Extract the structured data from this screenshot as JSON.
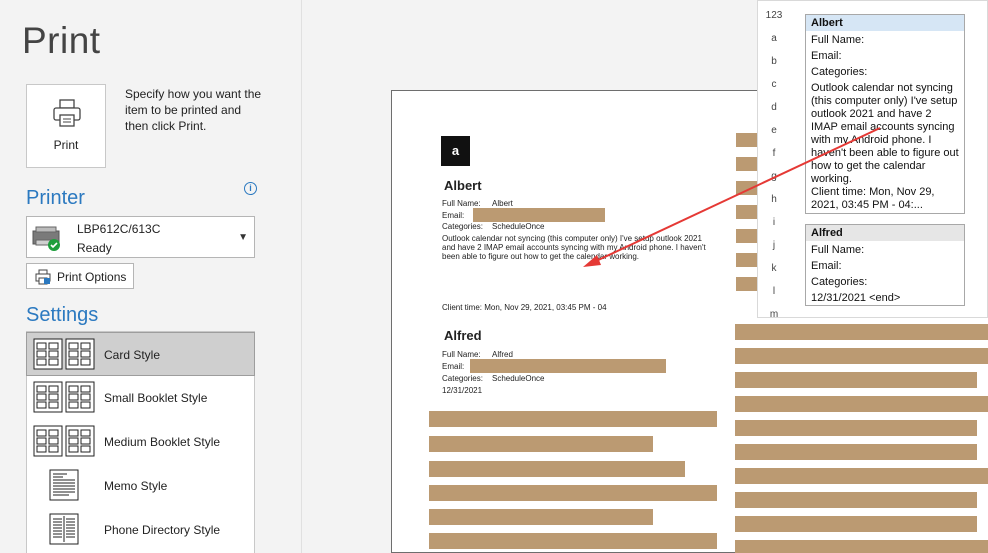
{
  "title": "Print",
  "print_button": {
    "label": "Print"
  },
  "instructions": "Specify how you want the item to be printed and then click Print.",
  "printer": {
    "heading": "Printer",
    "name": "LBP612C/613C",
    "status": "Ready",
    "options_label": "Print Options"
  },
  "settings": {
    "heading": "Settings",
    "styles": [
      {
        "label": "Card Style",
        "selected": true
      },
      {
        "label": "Small Booklet Style",
        "selected": false
      },
      {
        "label": "Medium Booklet Style",
        "selected": false
      },
      {
        "label": "Memo Style",
        "selected": false
      },
      {
        "label": "Phone Directory Style",
        "selected": false
      }
    ]
  },
  "preview": {
    "letter": "a",
    "contacts": [
      {
        "name": "Albert",
        "full_name_label": "Full Name:",
        "full_name": "Albert",
        "email_label": "Email:",
        "categories_label": "Categories:",
        "categories": "ScheduleOnce",
        "notes": "Outlook calendar not syncing (this computer only) I've setup outlook 2021 and have 2 IMAP email accounts syncing with my Android phone. I haven't been able to figure out how to get the calendar working.",
        "client_time": "Client time: Mon, Nov 29, 2021, 03:45 PM - 04"
      },
      {
        "name": "Alfred",
        "full_name_label": "Full Name:",
        "full_name": "Alfred",
        "email_label": "Email:",
        "categories_label": "Categories:",
        "categories": "ScheduleOnce",
        "date": "12/31/2021"
      }
    ]
  },
  "popup": {
    "index": [
      "123",
      "a",
      "b",
      "c",
      "d",
      "e",
      "f",
      "g",
      "h",
      "i",
      "j",
      "k",
      "l",
      "m"
    ],
    "cards": [
      {
        "name": "Albert",
        "full_name_label": "Full Name:",
        "email_label": "Email:",
        "categories_label": "Categories:",
        "notes": "Outlook calendar not syncing (this computer only) I've setup outlook 2021 and have 2 IMAP email accounts syncing with my Android phone. I haven't been able to figure out how to get the calendar working.",
        "client_time": "Client time: Mon, Nov 29, 2021, 03:45 PM - 04:..."
      },
      {
        "name": "Alfred",
        "full_name_label": "Full Name:",
        "email_label": "Email:",
        "categories_label": "Categories:",
        "date": "12/31/2021 <end>"
      }
    ]
  },
  "colors": {
    "accent": "#2b79c0",
    "redaction": "#bb9a72",
    "annotation_arrow": "#e53935",
    "selected_card_header": "#d6e6f5"
  }
}
